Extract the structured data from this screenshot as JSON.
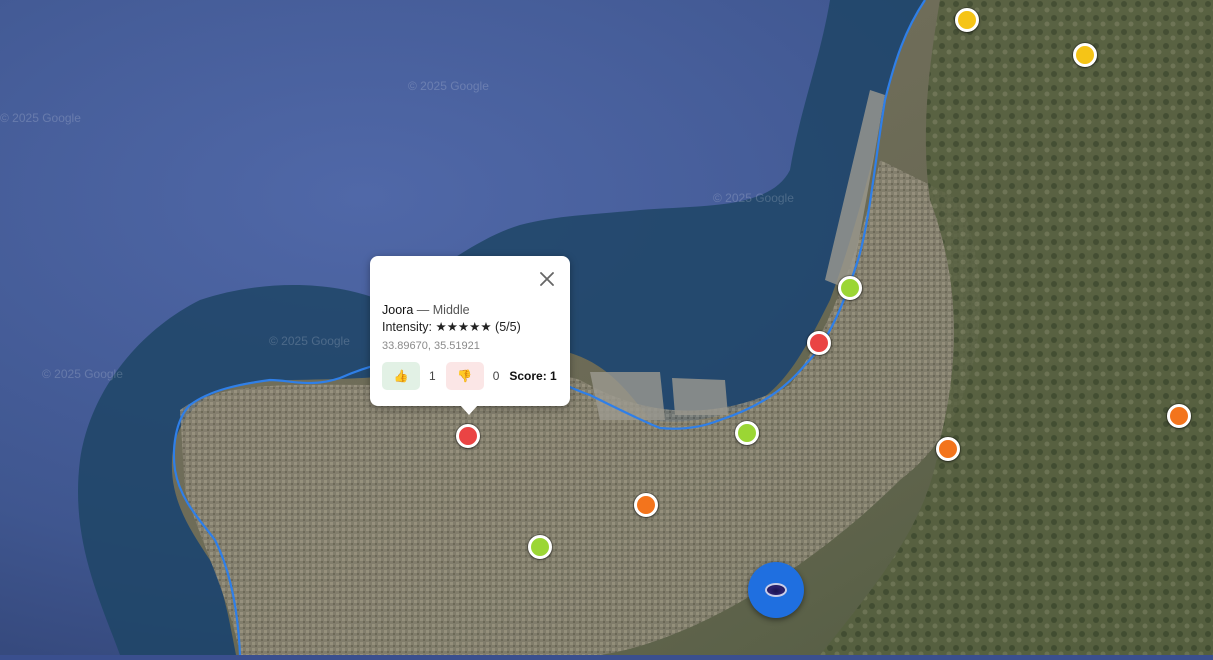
{
  "map": {
    "watermarks": [
      "© 2025 Google",
      "© 2025 Google",
      "© 2025 Google",
      "© 2025 Google",
      "© 2025 Google"
    ],
    "colors": {
      "sea_deep": "#3a4f8e",
      "sea_coast": "#1f4566",
      "land": "#6a6a55",
      "coastline": "#2f7fe8",
      "red": "#ea4444",
      "green": "#9bd634",
      "orange": "#f3741c",
      "yellow": "#f5c417"
    },
    "markers": [
      {
        "id": "m1",
        "color": "red"
      },
      {
        "id": "m2",
        "color": "red"
      },
      {
        "id": "m3",
        "color": "green"
      },
      {
        "id": "m4",
        "color": "green"
      },
      {
        "id": "m5",
        "color": "green"
      },
      {
        "id": "m6",
        "color": "orange"
      },
      {
        "id": "m7",
        "color": "orange"
      },
      {
        "id": "m8",
        "color": "orange"
      },
      {
        "id": "m9",
        "color": "yellow"
      },
      {
        "id": "m10",
        "color": "yellow"
      }
    ]
  },
  "popup": {
    "name": "Joora",
    "separator": "—",
    "level": "Middle",
    "intensity_label": "Intensity:",
    "intensity_stars": "★★★★★",
    "intensity_value": "(5/5)",
    "intensity_rating": 5,
    "coordinates": "33.89670, 35.51921",
    "upvote_icon": "thumbs-up-icon",
    "upvote_glyph": "👍",
    "upvotes": "1",
    "downvote_icon": "thumbs-down-icon",
    "downvote_glyph": "👎",
    "downvotes": "0",
    "score_label": "Score: 1",
    "close_icon": "close-icon"
  },
  "locate_button": {
    "icon": "location-icon"
  }
}
